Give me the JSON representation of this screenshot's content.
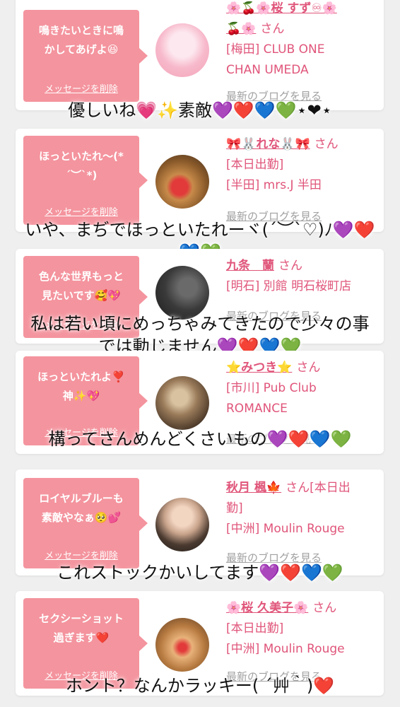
{
  "cards": [
    {
      "bubble": "鳴きたいときに鳴\nかしてあげよ😆",
      "delete_label": "メッセージを削除",
      "name": "🌸🍒🌸桜 すず♾🌸\n🍒🌸",
      "suffix": "さん",
      "line1": "[梅田] CLUB ONE",
      "line2": "CHAN UMEDA",
      "blog_link": "最新のブログを見る",
      "caption": "優しいね💗✨素敵💜❤️💙💚⋆❤⋆"
    },
    {
      "bubble": "ほっといたれ〜(*\n´︶`*)",
      "delete_label": "メッセージを削除",
      "name": "🎀🐰れな🐰🎀",
      "suffix": "さん",
      "line1": "[本日出勤]",
      "line2": "[半田] mrs.J 半田",
      "blog_link": "最新のブログを見る",
      "caption": "いや、まぢでほっといたれーヾ(´︶`♡)ﾉ💜❤️\n💙💚"
    },
    {
      "bubble": "色んな世界もっと\n見たいです🥰💖",
      "delete_label": "メッセージを削除",
      "name": "九条　蘭",
      "suffix": "さん",
      "line1": "[明石] 別館 明石桜町店",
      "line2": "",
      "blog_link": "最新のブログを見る",
      "caption": "私は若い頃にめっちゃみてきたので少々の事\nでは動じません💜❤️💙💚"
    },
    {
      "bubble": "ほっといたれよ❣️\n神✨💖",
      "delete_label": "メッセージを削除",
      "name": "⭐みつき⭐",
      "suffix": "さん",
      "line1": "[市川] Pub Club",
      "line2": "ROMANCE",
      "blog_link": "最新のブログを見る",
      "caption": "構ってさんめんどくさいもの💜❤️💙💚"
    },
    {
      "bubble": "ロイヤルブルーも\n素敵やなぁ🥺💕",
      "delete_label": "メッセージを削除",
      "name": "秋月 楓🍁",
      "suffix": "さん[本日出\n勤]",
      "line1": "[中洲] Moulin Rouge",
      "line2": "",
      "blog_link": "最新のブログを見る",
      "caption": "これストックかいしてます💜❤️💙💚"
    },
    {
      "bubble": "セクシーショット\n過ぎます❤️",
      "delete_label": "メッセージを削除",
      "name": "🌸桜 久美子🌸",
      "suffix": "さん",
      "line1": "[本日出勤]",
      "line2": "[中洲] Moulin Rouge",
      "blog_link": "最新のブログを見る",
      "caption": "ホント？なんかラッキー( ´艸｀)❤️"
    }
  ],
  "colors": {
    "bubble": "#f4949e",
    "name": "#e0557a",
    "link": "#a0a0a0"
  }
}
